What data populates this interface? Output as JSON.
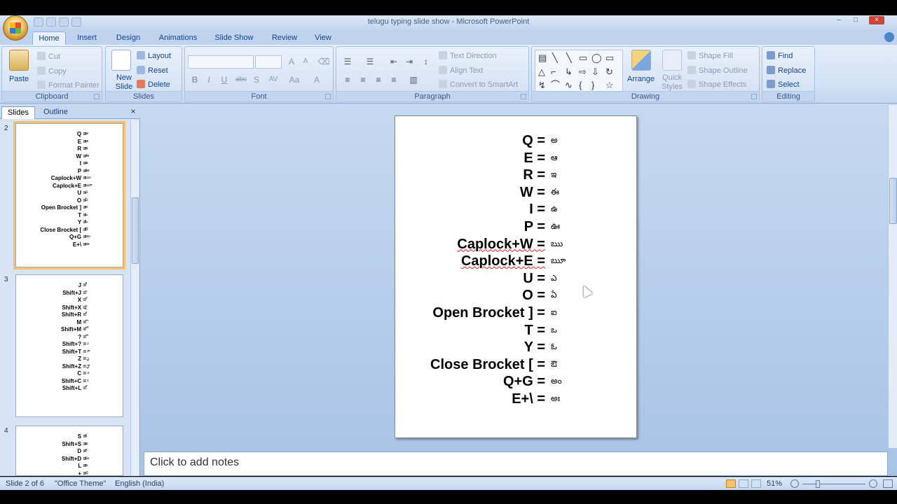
{
  "window": {
    "title": "telugu typing slide show - Microsoft PowerPoint",
    "controls": [
      "–",
      "□",
      "×"
    ]
  },
  "tabs": [
    "Home",
    "Insert",
    "Design",
    "Animations",
    "Slide Show",
    "Review",
    "View"
  ],
  "active_tab": "Home",
  "ribbon": {
    "clipboard": {
      "label": "Clipboard",
      "paste": "Paste",
      "cut": "Cut",
      "copy": "Copy",
      "format_painter": "Format Painter"
    },
    "slides": {
      "label": "Slides",
      "new_slide": "New Slide",
      "layout": "Layout",
      "reset": "Reset",
      "delete": "Delete"
    },
    "font": {
      "label": "Font",
      "bold": "B",
      "italic": "I",
      "underline": "U",
      "strike": "abc",
      "shadow": "S",
      "spacing": "AV",
      "case": "Aa",
      "color": "A"
    },
    "paragraph": {
      "label": "Paragraph",
      "text_direction": "Text Direction",
      "align_text": "Align Text",
      "convert_smartart": "Convert to SmartArt"
    },
    "drawing": {
      "label": "Drawing",
      "arrange": "Arrange",
      "quick_styles": "Quick Styles",
      "shape_fill": "Shape Fill",
      "shape_outline": "Shape Outline",
      "shape_effects": "Shape Effects"
    },
    "editing": {
      "label": "Editing",
      "find": "Find",
      "replace": "Replace",
      "select": "Select"
    }
  },
  "pane_tabs": {
    "slides": "Slides",
    "outline": "Outline",
    "close": "×"
  },
  "thumbnails": [
    {
      "number": "2",
      "rows": [
        {
          "key": "Q =",
          "val": "అ"
        },
        {
          "key": "E =",
          "val": "ఆ"
        },
        {
          "key": "R =",
          "val": "ఇ"
        },
        {
          "key": "W =",
          "val": "ఈ"
        },
        {
          "key": "I =",
          "val": "ఉ"
        },
        {
          "key": "P =",
          "val": "ఊ"
        },
        {
          "key": "Caplock+W =",
          "val": "ఋ"
        },
        {
          "key": "Caplock+E =",
          "val": "ౠ"
        },
        {
          "key": "U =",
          "val": "ఎ"
        },
        {
          "key": "O =",
          "val": "ఏ"
        },
        {
          "key": "Open Brocket ] =",
          "val": "ఐ"
        },
        {
          "key": "T =",
          "val": "ఒ"
        },
        {
          "key": "Y =",
          "val": "ఓ"
        },
        {
          "key": "Close Brocket [ =",
          "val": "ఔ"
        },
        {
          "key": "Q+G =",
          "val": "అం"
        },
        {
          "key": "E+\\ =",
          "val": "అః"
        }
      ]
    },
    {
      "number": "3",
      "rows": [
        {
          "key": "J =",
          "val": "ీ"
        },
        {
          "key": "Shift+J =",
          "val": "ె"
        },
        {
          "key": "X =",
          "val": "ే"
        },
        {
          "key": "Shift+X =",
          "val": "ై"
        },
        {
          "key": "Shift+R =",
          "val": "ి"
        },
        {
          "key": "M =",
          "val": "ొ"
        },
        {
          "key": "Shift+M =",
          "val": "ో"
        },
        {
          "key": "? =",
          "val": "ౌ"
        },
        {
          "key": "Shift+? =",
          "val": "ు"
        },
        {
          "key": "Shift+T =",
          "val": "ూ"
        },
        {
          "key": "Z =",
          "val": "ృ"
        },
        {
          "key": "Shift+Z =",
          "val": "ౄ"
        },
        {
          "key": "C =",
          "val": "ం"
        },
        {
          "key": "Shift+C =",
          "val": "ః"
        },
        {
          "key": "Shift+L =",
          "val": "్"
        }
      ]
    },
    {
      "number": "4",
      "rows": [
        {
          "key": "S =",
          "val": "క"
        },
        {
          "key": "Shift+S =",
          "val": "ఖ"
        },
        {
          "key": "D =",
          "val": "గ"
        },
        {
          "key": "Shift+D =",
          "val": "ఘ"
        },
        {
          "key": "L =",
          "val": "ఙ"
        },
        {
          "key": "+ =",
          "val": "చ"
        }
      ]
    }
  ],
  "slide": {
    "rows": [
      {
        "key": "Q =",
        "val": "అ"
      },
      {
        "key": "E =",
        "val": "ఆ"
      },
      {
        "key": "R =",
        "val": "ఇ"
      },
      {
        "key": "W =",
        "val": "ఈ"
      },
      {
        "key": "I =",
        "val": "ఉ"
      },
      {
        "key": "P =",
        "val": "ఊ"
      },
      {
        "key": "Caplock+W =",
        "val": "ఋ",
        "spell": true
      },
      {
        "key": "Caplock+E =",
        "val": "ౠ",
        "spell": true
      },
      {
        "key": "U =",
        "val": "ఎ"
      },
      {
        "key": "O =",
        "val": "ఏ"
      },
      {
        "key": "Open Brocket ] =",
        "val": "ఐ"
      },
      {
        "key": "T =",
        "val": "ఒ"
      },
      {
        "key": "Y =",
        "val": "ఓ"
      },
      {
        "key": "Close Brocket [ =",
        "val": "ఔ"
      },
      {
        "key": "Q+G =",
        "val": "అం"
      },
      {
        "key": "E+\\ =",
        "val": "అః"
      }
    ]
  },
  "notes": {
    "placeholder": "Click to add notes"
  },
  "status": {
    "slide_info": "Slide 2 of 6",
    "theme": "\"Office Theme\"",
    "language": "English (India)",
    "zoom": "51%"
  }
}
